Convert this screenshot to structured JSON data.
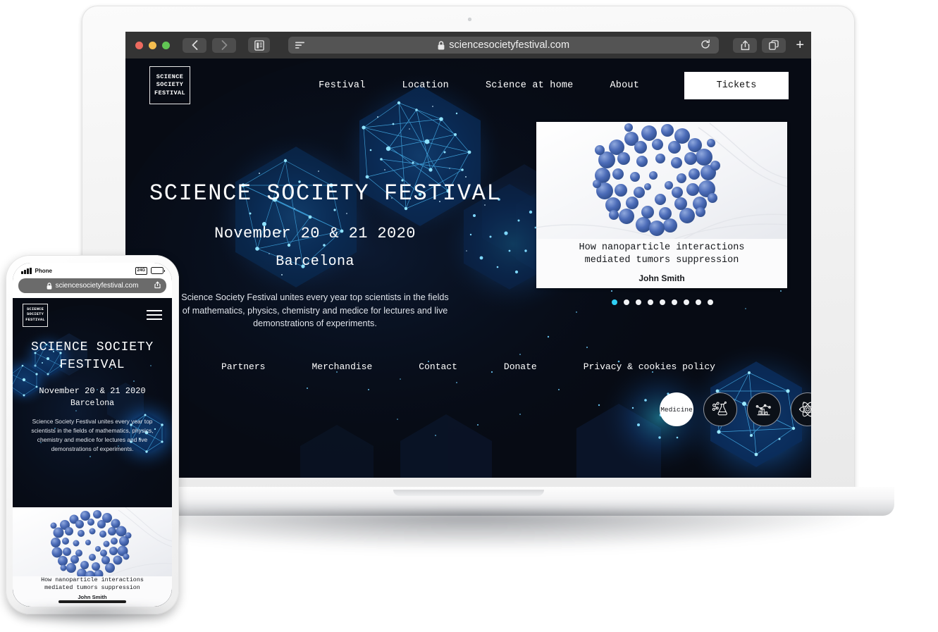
{
  "browser": {
    "url": "sciencesocietyfestival.com",
    "lock_icon": "lock-icon",
    "reload_icon": "reload-icon",
    "back_icon": "back-chevron-icon",
    "forward_icon": "forward-chevron-icon",
    "sidebar_icon": "sidebar-toggle-icon",
    "reader_icon": "reader-view-icon",
    "share_icon": "share-icon",
    "tabs_icon": "tab-overview-icon",
    "newtab_label": "+"
  },
  "site": {
    "logo": {
      "line1": "SCIENCE",
      "line2": "SOCIETY",
      "line3": "FESTIVAL"
    },
    "nav": [
      {
        "label": "Festival"
      },
      {
        "label": "Location"
      },
      {
        "label": "Science at home"
      },
      {
        "label": "About"
      }
    ],
    "cta": {
      "label": "Tickets"
    },
    "hero": {
      "title": "SCIENCE SOCIETY FESTIVAL",
      "date": "November 20 & 21 2020",
      "city": "Barcelona",
      "description": "Science Society Festival unites every year top scientists in the fields of mathematics, physics, chemistry and medice for lectures and live demonstrations of experiments."
    },
    "card": {
      "title": "How nanoparticle interactions mediated tumors suppression",
      "title_line1": "How nanoparticle interactions",
      "title_line2": "mediated tumors suppression",
      "author": "John Smith",
      "image_alt": "nanoparticle-cluster-image"
    },
    "carousel": {
      "total": 9,
      "active_index": 0,
      "active_color": "#2fd0f5",
      "inactive_color": "#f1f3f6"
    },
    "categories": [
      {
        "label": "Medicine",
        "icon": "medicine-label",
        "active": true
      },
      {
        "label": "",
        "icon": "chemistry-flask-icon",
        "active": false
      },
      {
        "label": "",
        "icon": "statistics-chart-icon",
        "active": false
      },
      {
        "label": "",
        "icon": "atom-icon",
        "active": false
      }
    ],
    "footer": [
      {
        "label": "Partners"
      },
      {
        "label": "Merchandise"
      },
      {
        "label": "Contact"
      },
      {
        "label": "Donate"
      },
      {
        "label": "Privacy & cookies policy"
      }
    ]
  },
  "phone": {
    "status": {
      "carrier": "Phone",
      "signal_icon": "signal-bars-icon",
      "battery_label": "24G",
      "battery_icon": "battery-icon"
    },
    "url": "sciencesocietyfestival.com",
    "menu_icon": "hamburger-menu-icon",
    "share_icon": "share-icon",
    "lock_icon": "lock-icon"
  },
  "theme": {
    "site_bg": "#070b14",
    "accent": "#2fd0f5",
    "hex_glow": "#1f8fe8",
    "chrome_bg": "#343434",
    "device_frame": "#f4f4f4"
  }
}
